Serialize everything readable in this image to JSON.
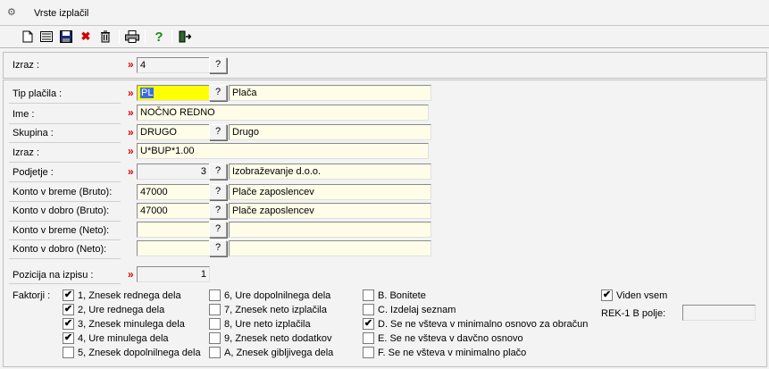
{
  "window": {
    "title": "Vrste izplačil"
  },
  "toolbar": {
    "items": [
      {
        "name": "new-icon",
        "glyph": "🗋"
      },
      {
        "name": "list-icon",
        "glyph": "▤"
      },
      {
        "name": "save-icon",
        "glyph": "🖫"
      },
      {
        "name": "delete-icon",
        "glyph": "✖"
      },
      {
        "name": "trash-icon",
        "glyph": "🗑"
      },
      {
        "name": "print-icon",
        "glyph": "🖶"
      },
      {
        "name": "help-icon",
        "glyph": "?"
      },
      {
        "name": "exit-icon",
        "glyph": "⇥"
      }
    ]
  },
  "top": {
    "izraz_label": "Izraz :",
    "izraz_value": "4",
    "q": "?"
  },
  "form": {
    "req": "»",
    "tip_placila": {
      "label": "Tip plačila :",
      "value": "PL",
      "desc": "Plača"
    },
    "ime": {
      "label": "Ime :",
      "value": "NOČNO REDNO"
    },
    "skupina": {
      "label": "Skupina :",
      "value": "DRUGO",
      "desc": "Drugo"
    },
    "izraz": {
      "label": "Izraz :",
      "value": "U*BUP*1.00"
    },
    "podjetje": {
      "label": "Podjetje :",
      "value": "3",
      "desc": "Izobraževanje d.o.o."
    },
    "konto_breme_bruto": {
      "label": "Konto v breme (Bruto):",
      "value": "47000",
      "desc": "Plače zaposlencev"
    },
    "konto_dobro_bruto": {
      "label": "Konto v dobro (Bruto):",
      "value": "47000",
      "desc": "Plače zaposlencev"
    },
    "konto_breme_neto": {
      "label": "Konto v breme (Neto):",
      "value": "",
      "desc": ""
    },
    "konto_dobro_neto": {
      "label": "Konto v dobro (Neto):",
      "value": "",
      "desc": ""
    },
    "pozicija": {
      "label": "Pozicija na izpisu :",
      "value": "1"
    }
  },
  "faktorji": {
    "label": "Faktorji :",
    "col1": [
      {
        "label": "1, Znesek rednega dela",
        "checked": true
      },
      {
        "label": "2, Ure rednega dela",
        "checked": true
      },
      {
        "label": "3, Znesek minulega dela",
        "checked": true
      },
      {
        "label": "4, Ure minulega dela",
        "checked": true
      },
      {
        "label": "5, Znesek dopolnilnega dela",
        "checked": false
      }
    ],
    "col2": [
      {
        "label": "6, Ure dopolnilnega dela",
        "checked": false
      },
      {
        "label": "7, Znesek neto izplačila",
        "checked": false
      },
      {
        "label": "8, Ure neto izplačila",
        "checked": false
      },
      {
        "label": "9, Znesek neto dodatkov",
        "checked": false
      },
      {
        "label": "A, Znesek gibljivega dela",
        "checked": false
      }
    ],
    "col3": [
      {
        "label": "B. Bonitete",
        "checked": false
      },
      {
        "label": "C. Izdelaj seznam",
        "checked": false
      },
      {
        "label": "D. Se ne všteva v minimalno osnovo za obračun",
        "checked": true
      },
      {
        "label": "E. Se ne všteva v davčno osnovo",
        "checked": false
      },
      {
        "label": "F. Se ne všteva v minimalno plačo",
        "checked": false
      }
    ]
  },
  "viden": {
    "label": "Viden vsem",
    "checked": true
  },
  "rek": {
    "label": "REK-1 B polje:",
    "value": ""
  },
  "check_glyph": "✔"
}
